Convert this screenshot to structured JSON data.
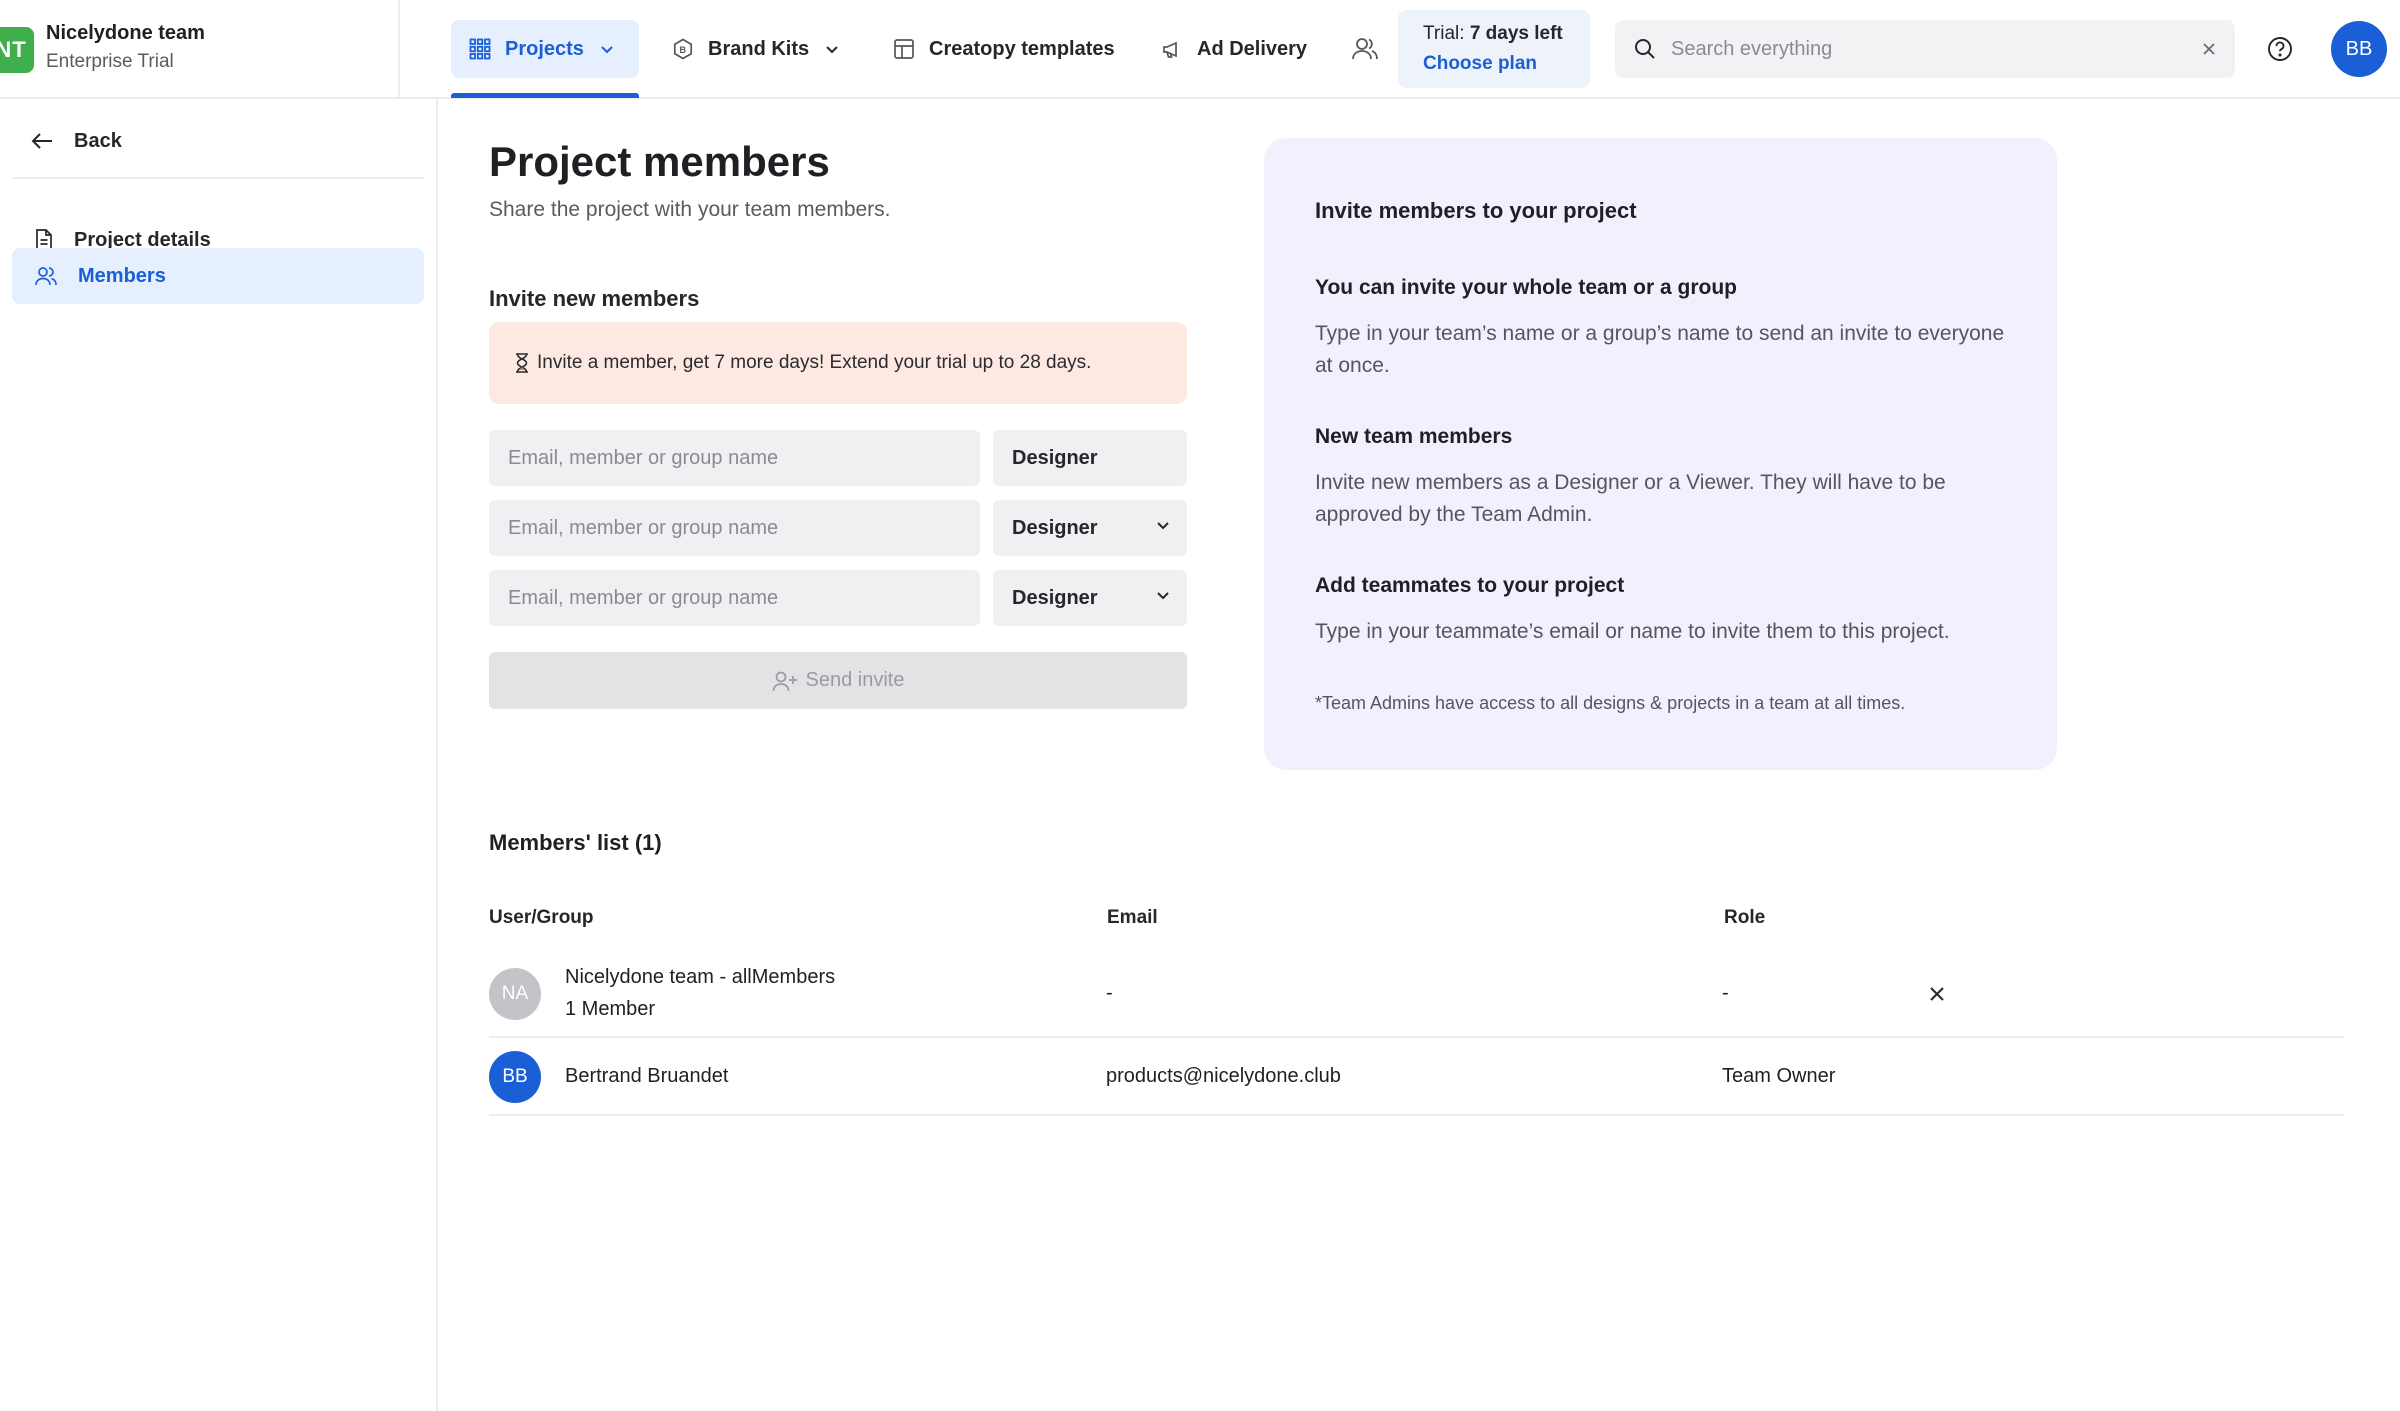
{
  "header": {
    "team_initials": "NT",
    "team_name": "Nicelydone team",
    "team_plan": "Enterprise Trial",
    "nav": {
      "projects": "Projects",
      "brand_kits": "Brand Kits",
      "templates": "Creatopy templates",
      "ad_delivery": "Ad Delivery"
    },
    "trial": {
      "prefix": "Trial:",
      "days": "7 days left",
      "link": "Choose plan"
    },
    "search_placeholder": "Search everything",
    "user_initials": "BB"
  },
  "sidebar": {
    "back": "Back",
    "items": [
      {
        "label": "Project details",
        "active": false
      },
      {
        "label": "Members",
        "active": true
      }
    ]
  },
  "main": {
    "title": "Project members",
    "subtitle": "Share the project with your team members.",
    "invite_heading": "Invite new members",
    "promo": "Invite a member, get 7 more days! Extend your trial up to 28 days.",
    "email_placeholder": "Email, member or group name",
    "rows": [
      {
        "role": "Designer"
      },
      {
        "role": "Designer"
      },
      {
        "role": "Designer"
      }
    ],
    "send_invite": "Send invite"
  },
  "info": {
    "title": "Invite members to your project",
    "sections": [
      {
        "heading": "You can invite your whole team or a group",
        "text": "Type in your team’s name or a group’s name to send an invite to everyone at once."
      },
      {
        "heading": "New team members",
        "text": "Invite new members as a Designer or a Viewer. They will have to be approved by the Team Admin."
      },
      {
        "heading": "Add teammates to your project",
        "text": "Type in your teammate’s email or name to invite them to this project."
      }
    ],
    "note": "*Team Admins have access to all designs & projects in a team at all times."
  },
  "members": {
    "title": "Members' list (1)",
    "columns": {
      "user": "User/Group",
      "email": "Email",
      "role": "Role"
    },
    "rows": [
      {
        "initials": "NA",
        "name": "Nicelydone team - allMembers",
        "sub": "1 Member",
        "email": "-",
        "role": "-"
      },
      {
        "initials": "BB",
        "name": "Bertrand Bruandet",
        "email": "products@nicelydone.club",
        "role": "Team Owner"
      }
    ]
  },
  "colors": {
    "accent": "#1b5fd6",
    "team_logo": "#3fae4c",
    "promo_bg": "#fde9e2",
    "info_bg": "#f3f0fd",
    "active_bg": "#e5effd"
  }
}
